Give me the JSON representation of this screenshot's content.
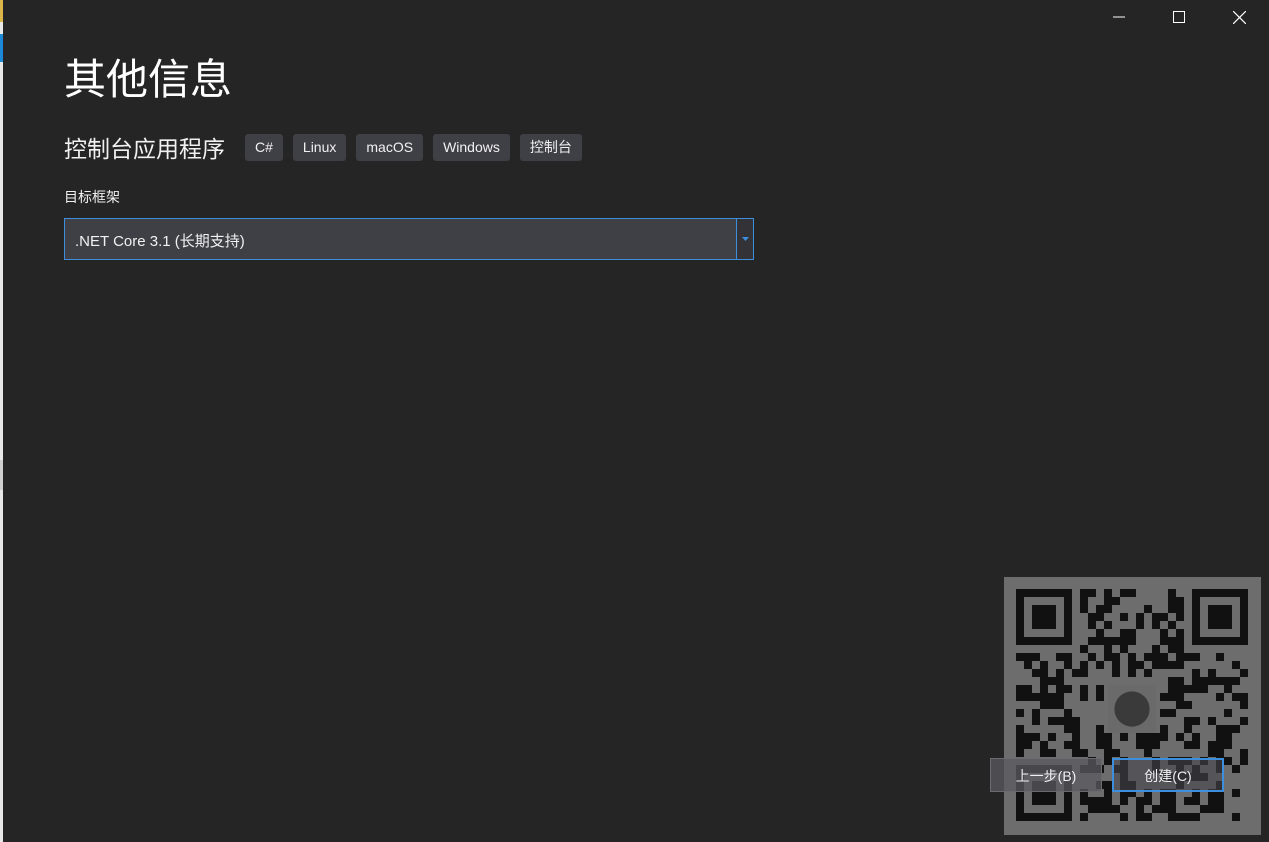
{
  "window": {
    "controls": {
      "minimize_icon": "minimize-icon",
      "maximize_icon": "maximize-icon",
      "close_icon": "close-icon"
    }
  },
  "page": {
    "title": "其他信息",
    "project_type": "控制台应用程序",
    "tags": [
      "C#",
      "Linux",
      "macOS",
      "Windows",
      "控制台"
    ]
  },
  "framework": {
    "label": "目标框架",
    "selected": ".NET Core 3.1 (长期支持)"
  },
  "buttons": {
    "back": "上一步(B)",
    "create": "创建(C)"
  },
  "colors": {
    "background": "#252526",
    "accent": "#3e8ede",
    "tag_background": "#3f3f46",
    "text": "#f1f1f1"
  }
}
